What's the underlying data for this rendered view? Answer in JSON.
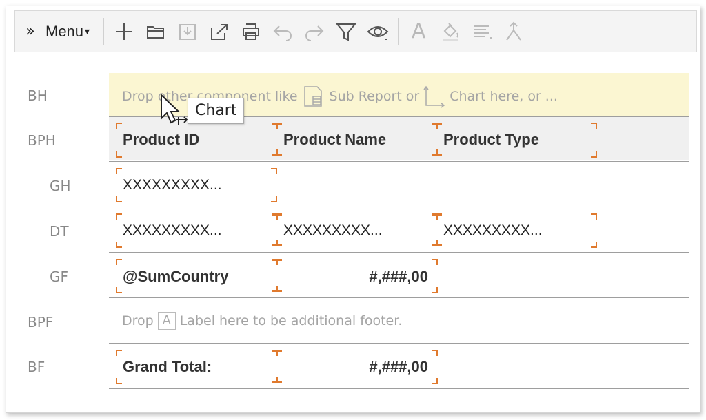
{
  "toolbar": {
    "expand_label": "»",
    "menu_label": "Menu",
    "menu_caret": "▾",
    "text_tool_glyph": "A",
    "icons": [
      "plus-icon",
      "folder-open-icon",
      "download-icon",
      "share-export-icon",
      "printer-icon",
      "undo-icon",
      "redo-icon",
      "filter-icon",
      "eye-icon",
      "text-icon",
      "fill-icon",
      "align-icon",
      "merge-icon"
    ]
  },
  "bands": {
    "bh": "BH",
    "bph": "BPH",
    "gh": "GH",
    "dt": "DT",
    "gf": "GF",
    "bpf": "BPF",
    "bf": "BF"
  },
  "drop_hint": {
    "part1": "Drop other component like",
    "part2": "Sub Report or",
    "part3": "Chart here, or ..."
  },
  "tooltip": "Chart",
  "headers": {
    "col1": "Product ID",
    "col2": "Product Name",
    "col3": "Product Type"
  },
  "group_header": {
    "col1": "XXXXXXXXX..."
  },
  "detail": {
    "col1": "XXXXXXXXX...",
    "col2": "XXXXXXXXX...",
    "col3": "XXXXXXXXX..."
  },
  "group_footer": {
    "label": "@SumCountry",
    "value": "#,###,00"
  },
  "page_footer_hint": {
    "part1": "Drop",
    "label_glyph": "A",
    "part2": "Label here to be additional footer."
  },
  "band_footer": {
    "label": "Grand Total:",
    "value": "#,###,00"
  },
  "colors": {
    "accent_orange": "#e07a2e",
    "header_band_bg": "#fbf6d2",
    "column_header_bg": "#f0f0f0"
  }
}
